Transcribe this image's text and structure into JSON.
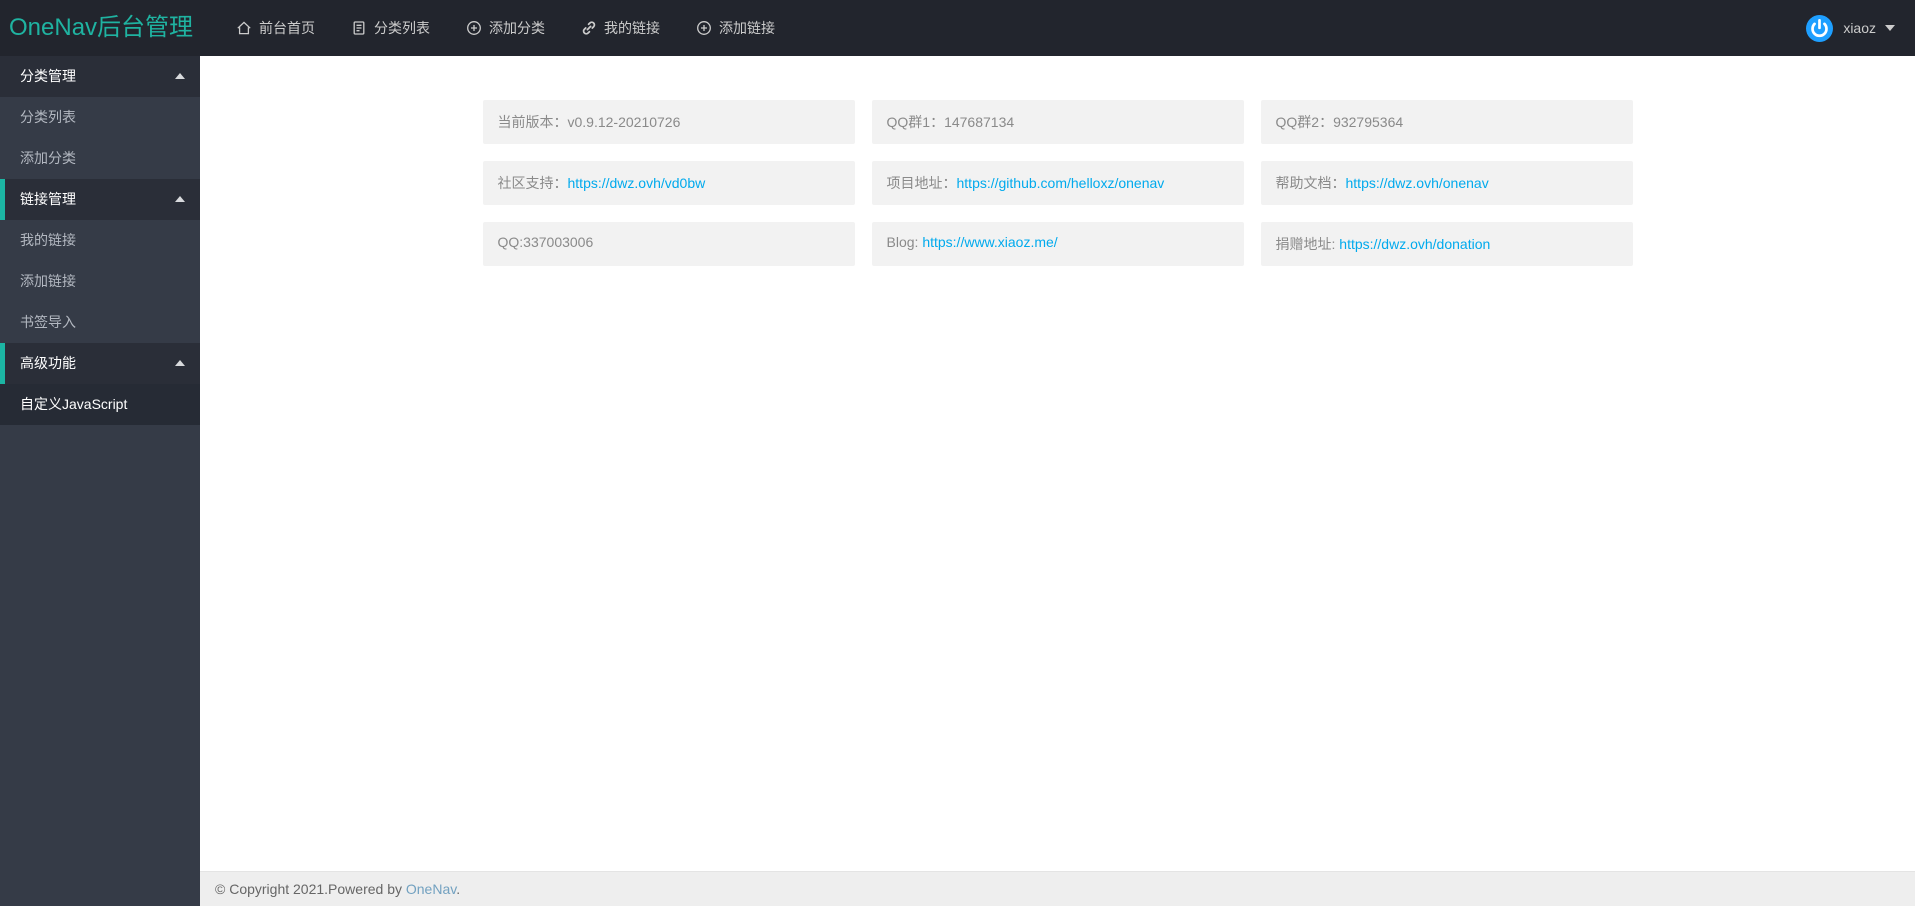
{
  "colors": {
    "accent_teal": "#1cb5a3",
    "navbar_bg": "#22252d",
    "sidebar_bg": "#353b47",
    "sidebar_header_bg": "#2a2e38",
    "link_blue": "#01aaed",
    "avatar_blue": "#1e9fff",
    "footer_bg": "#eeeeee"
  },
  "header": {
    "logo": "OneNav后台管理",
    "nav_items": [
      {
        "label": "前台首页",
        "icon": "home-icon"
      },
      {
        "label": "分类列表",
        "icon": "document-icon"
      },
      {
        "label": "添加分类",
        "icon": "plus-circle-icon"
      },
      {
        "label": "我的链接",
        "icon": "link-icon"
      },
      {
        "label": "添加链接",
        "icon": "plus-circle-icon"
      }
    ],
    "user": {
      "name": "xiaoz",
      "avatar_icon": "power-icon"
    }
  },
  "sidebar": {
    "sections": [
      {
        "title": "分类管理",
        "items": [
          {
            "label": "分类列表"
          },
          {
            "label": "添加分类"
          }
        ]
      },
      {
        "title": "链接管理",
        "items": [
          {
            "label": "我的链接"
          },
          {
            "label": "添加链接"
          },
          {
            "label": "书签导入"
          }
        ]
      },
      {
        "title": "高级功能",
        "items": [
          {
            "label": "自定义JavaScript",
            "active": true
          }
        ]
      }
    ]
  },
  "cards": [
    {
      "label": "当前版本：v0.9.12-20210726"
    },
    {
      "label": "QQ群1：147687134"
    },
    {
      "label": "QQ群2：932795364"
    },
    {
      "label": "社区支持：",
      "link": "https://dwz.ovh/vd0bw"
    },
    {
      "label": "项目地址：",
      "link": "https://github.com/helloxz/onenav"
    },
    {
      "label": "帮助文档：",
      "link": "https://dwz.ovh/onenav"
    },
    {
      "label": "QQ:337003006"
    },
    {
      "label": "Blog: ",
      "link": "https://www.xiaoz.me/"
    },
    {
      "label": "捐赠地址: ",
      "link": "https://dwz.ovh/donation"
    }
  ],
  "footer": {
    "prefix": "© Copyright 2021.Powered by ",
    "link_label": "OneNav",
    "suffix": "."
  }
}
